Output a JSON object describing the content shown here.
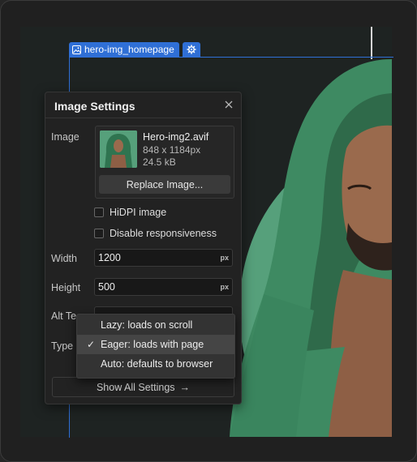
{
  "element_tag": {
    "name": "hero-img_homepage"
  },
  "panel": {
    "title": "Image Settings",
    "image_label": "Image",
    "file": {
      "name": "Hero-img2.avif",
      "dimensions": "848 x 1184px",
      "size": "24.5 kB"
    },
    "replace_label": "Replace Image...",
    "hidpi_label": "HiDPI image",
    "hidpi_checked": false,
    "disable_resp_label": "Disable responsiveness",
    "disable_resp_checked": false,
    "width_label": "Width",
    "width_value": "1200",
    "height_label": "Height",
    "height_value": "500",
    "unit": "px",
    "alt_label": "Alt Te",
    "type_label": "Type",
    "show_all_label": "Show All Settings",
    "show_all_arrow": "→"
  },
  "loading_menu": {
    "options": [
      {
        "label": "Lazy: loads on scroll",
        "selected": false
      },
      {
        "label": "Eager: loads with page",
        "selected": true
      },
      {
        "label": "Auto: defaults to browser",
        "selected": false
      }
    ]
  },
  "colors": {
    "accent": "#2f6fd6",
    "hero_green": "#56a07b"
  }
}
